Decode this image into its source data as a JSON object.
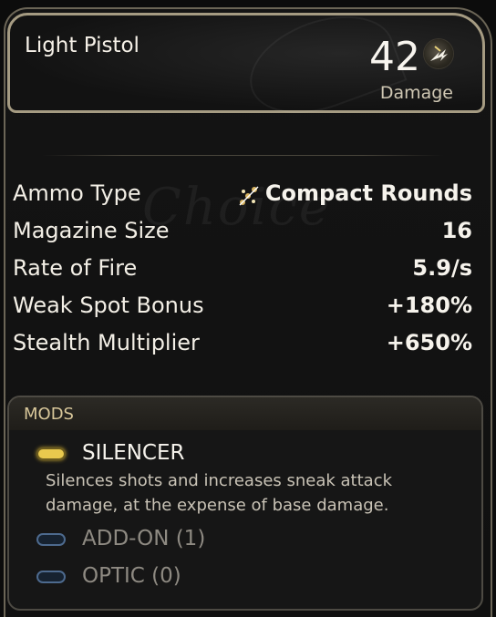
{
  "weapon": {
    "name": "Light Pistol",
    "damage_value": "42",
    "damage_label": "Damage",
    "damage_icon": "damage-burst-icon"
  },
  "watermark": "Choice",
  "stats": [
    {
      "label": "Ammo Type",
      "value": "Compact Rounds",
      "icon": "compact-rounds-icon"
    },
    {
      "label": "Magazine Size",
      "value": "16"
    },
    {
      "label": "Rate of Fire",
      "value": "5.9/s"
    },
    {
      "label": "Weak Spot Bonus",
      "value": "+180%"
    },
    {
      "label": "Stealth Multiplier",
      "value": "+650%"
    }
  ],
  "mods": {
    "title": "MODS",
    "items": [
      {
        "label": "SILENCER",
        "state": "active",
        "description": "Silences shots and increases sneak attack damage, at the expense of base damage."
      },
      {
        "label": "ADD-ON (1)",
        "state": "empty"
      },
      {
        "label": "OPTIC (0)",
        "state": "empty"
      }
    ]
  },
  "colors": {
    "accent_gold": "#e9c94e",
    "frame": "#a59b82",
    "mod_empty_outline": "#4d6a8e"
  }
}
